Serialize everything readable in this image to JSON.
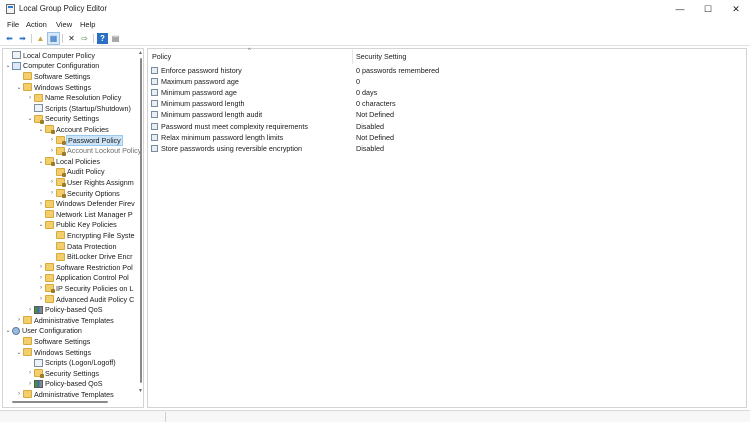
{
  "window": {
    "title": "Local Group Policy Editor",
    "controls": {
      "minimize": "—",
      "maximize": "☐",
      "close": "✕"
    }
  },
  "menu": [
    "File",
    "Action",
    "View",
    "Help"
  ],
  "toolbar": {
    "icons": [
      "back-icon",
      "forward-icon",
      "up-folder-icon",
      "show-hide-tree-icon",
      "delete-icon",
      "export-list-icon",
      "help-icon",
      "properties-icon"
    ],
    "glyphs": {
      "back": "⬅",
      "forward": "➡",
      "up": "▲",
      "tree": "▦",
      "delete": "✕",
      "export": "⇨",
      "help": "?",
      "props": "▤"
    },
    "colors": {
      "back": "#2a6fc4",
      "forward": "#2a6fc4",
      "help": "#2a6fc4"
    }
  },
  "tree": {
    "items": [
      {
        "label": "Local Computer Policy",
        "level": 0,
        "toggle": "",
        "icon": "doc-icon"
      },
      {
        "label": "Computer Configuration",
        "level": 0,
        "toggle": "⌄",
        "icon": "computer-icon"
      },
      {
        "label": "Software Settings",
        "level": 1,
        "toggle": "",
        "icon": "folder-icon"
      },
      {
        "label": "Windows Settings",
        "level": 1,
        "toggle": "⌄",
        "icon": "folder-icon"
      },
      {
        "label": "Name Resolution Policy",
        "level": 2,
        "toggle": "›",
        "icon": "folder-icon"
      },
      {
        "label": "Scripts (Startup/Shutdown)",
        "level": 2,
        "toggle": "",
        "icon": "doc-icon"
      },
      {
        "label": "Security Settings",
        "level": 2,
        "toggle": "⌄",
        "icon": "lock-folder-icon"
      },
      {
        "label": "Account Policies",
        "level": 3,
        "toggle": "⌄",
        "icon": "lock-folder-icon"
      },
      {
        "label": "Password Policy",
        "level": 4,
        "toggle": "›",
        "icon": "lock-folder-icon",
        "selected": true
      },
      {
        "label": "Account Lockout Policy",
        "level": 4,
        "toggle": "›",
        "icon": "lock-folder-icon",
        "dim": true
      },
      {
        "label": "Local Policies",
        "level": 3,
        "toggle": "⌄",
        "icon": "lock-folder-icon"
      },
      {
        "label": "Audit Policy",
        "level": 4,
        "toggle": "",
        "icon": "lock-folder-icon"
      },
      {
        "label": "User Rights Assignm",
        "level": 4,
        "toggle": "›",
        "icon": "lock-folder-icon"
      },
      {
        "label": "Security Options",
        "level": 4,
        "toggle": "›",
        "icon": "lock-folder-icon"
      },
      {
        "label": "Windows Defender Firev",
        "level": 3,
        "toggle": "›",
        "icon": "folder-icon"
      },
      {
        "label": "Network List Manager P",
        "level": 3,
        "toggle": "",
        "icon": "folder-icon"
      },
      {
        "label": "Public Key Policies",
        "level": 3,
        "toggle": "⌄",
        "icon": "folder-icon"
      },
      {
        "label": "Encrypting File Syste",
        "level": 4,
        "toggle": "",
        "icon": "folder-icon"
      },
      {
        "label": "Data Protection",
        "level": 4,
        "toggle": "",
        "icon": "folder-icon"
      },
      {
        "label": "BitLocker Drive Encr",
        "level": 4,
        "toggle": "",
        "icon": "folder-icon"
      },
      {
        "label": "Software Restriction Pol",
        "level": 3,
        "toggle": "›",
        "icon": "folder-icon"
      },
      {
        "label": "Application Control Pol",
        "level": 3,
        "toggle": "›",
        "icon": "folder-icon"
      },
      {
        "label": "IP Security Policies on L",
        "level": 3,
        "toggle": "›",
        "icon": "lock-folder-icon"
      },
      {
        "label": "Advanced Audit Policy C",
        "level": 3,
        "toggle": "›",
        "icon": "folder-icon"
      },
      {
        "label": "Policy-based QoS",
        "level": 2,
        "toggle": "›",
        "icon": "qos-icon"
      },
      {
        "label": "Administrative Templates",
        "level": 1,
        "toggle": "›",
        "icon": "folder-icon"
      },
      {
        "label": "User Configuration",
        "level": 0,
        "toggle": "⌄",
        "icon": "user-icon"
      },
      {
        "label": "Software Settings",
        "level": 1,
        "toggle": "",
        "icon": "folder-icon"
      },
      {
        "label": "Windows Settings",
        "level": 1,
        "toggle": "⌄",
        "icon": "folder-icon"
      },
      {
        "label": "Scripts (Logon/Logoff)",
        "level": 2,
        "toggle": "",
        "icon": "doc-icon"
      },
      {
        "label": "Security Settings",
        "level": 2,
        "toggle": "›",
        "icon": "lock-folder-icon"
      },
      {
        "label": "Policy-based QoS",
        "level": 2,
        "toggle": "›",
        "icon": "qos-icon"
      },
      {
        "label": "Administrative Templates",
        "level": 1,
        "toggle": "›",
        "icon": "folder-icon"
      }
    ]
  },
  "list": {
    "columns": {
      "policy": "Policy",
      "setting": "Security Setting",
      "sort_indicator": "^"
    },
    "rows": [
      {
        "policy": "Enforce password history",
        "setting": "0 passwords remembered"
      },
      {
        "policy": "Maximum password age",
        "setting": "0"
      },
      {
        "policy": "Minimum password age",
        "setting": "0 days"
      },
      {
        "policy": "Minimum password length",
        "setting": "0 characters"
      },
      {
        "policy": "Minimum password length audit",
        "setting": "Not Defined"
      },
      {
        "policy": "Password must meet complexity requirements",
        "setting": "Disabled"
      },
      {
        "policy": "Relax minimum password length limits",
        "setting": "Not Defined"
      },
      {
        "policy": "Store passwords using reversible encryption",
        "setting": "Disabled"
      }
    ]
  },
  "scroll": {
    "up": "▲",
    "down": "▼"
  },
  "colors": {
    "selection": "#cce4f7",
    "folder": "#f3cf6b",
    "accent": "#2a6fc4"
  }
}
